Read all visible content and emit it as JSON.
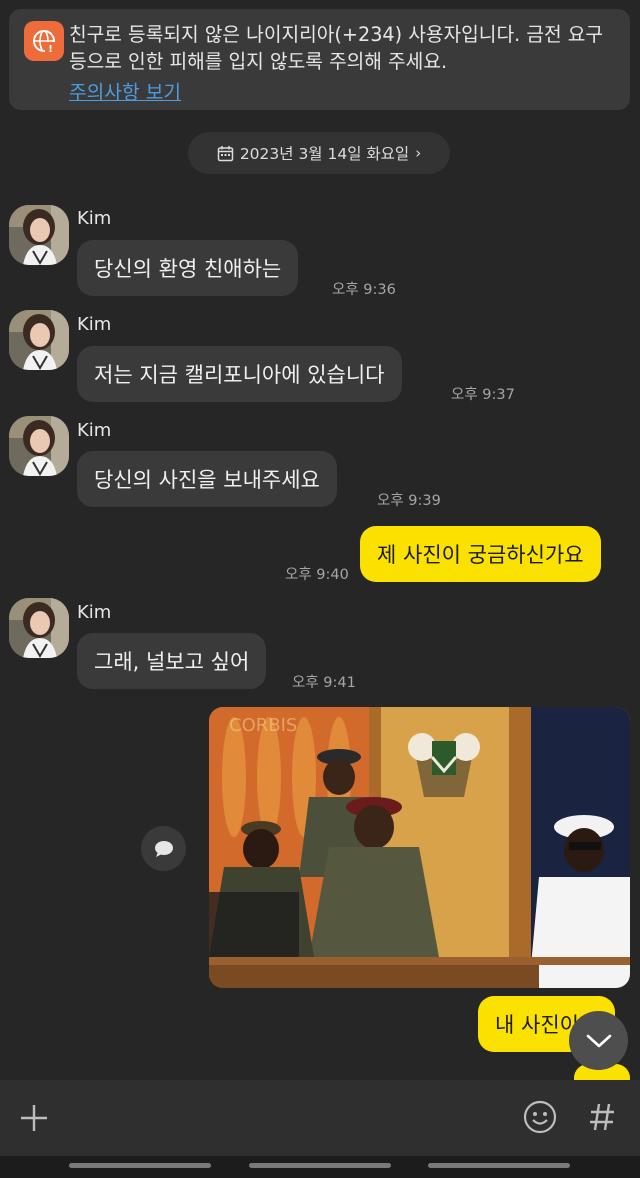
{
  "warning": {
    "text": "친구로 등록되지 않은 나이지리아(+234) 사용자입니다. 금전 요구 등으로 인한 피해를 입지 않도록 주의해 주세요.",
    "link": "주의사항 보기",
    "icon": "globe-warning-icon"
  },
  "date_divider": {
    "label": "2023년 3월 14일 화요일",
    "icon": "calendar-icon"
  },
  "messages": [
    {
      "sender": "Kim",
      "text": "당신의 환영 친애하는",
      "time": "오후 9:36"
    },
    {
      "sender": "Kim",
      "text": "저는 지금 캘리포니아에 있습니다",
      "time": "오후 9:37"
    },
    {
      "sender": "Kim",
      "text": "당신의 사진을 보내주세요",
      "time": "오후 9:39"
    },
    {
      "sender": "me",
      "text": "제 사진이 궁금하신가요",
      "time": "오후 9:40"
    },
    {
      "sender": "Kim",
      "text": "그래, 널보고 싶어",
      "time": "오후 9:41"
    },
    {
      "sender": "me",
      "type": "photo",
      "watermark": "CORBIS"
    },
    {
      "sender": "me",
      "text": "내 사진이다"
    }
  ],
  "input_bar": {
    "plus_icon": "plus-icon",
    "emoji_icon": "emoji-icon",
    "hash_icon": "hash-icon"
  },
  "colors": {
    "background": "#262626",
    "outgoing_bubble": "#fae100",
    "incoming_bubble": "#3a3a3a",
    "link": "#4d9ce0",
    "warning_icon": "#ee6c3a"
  }
}
